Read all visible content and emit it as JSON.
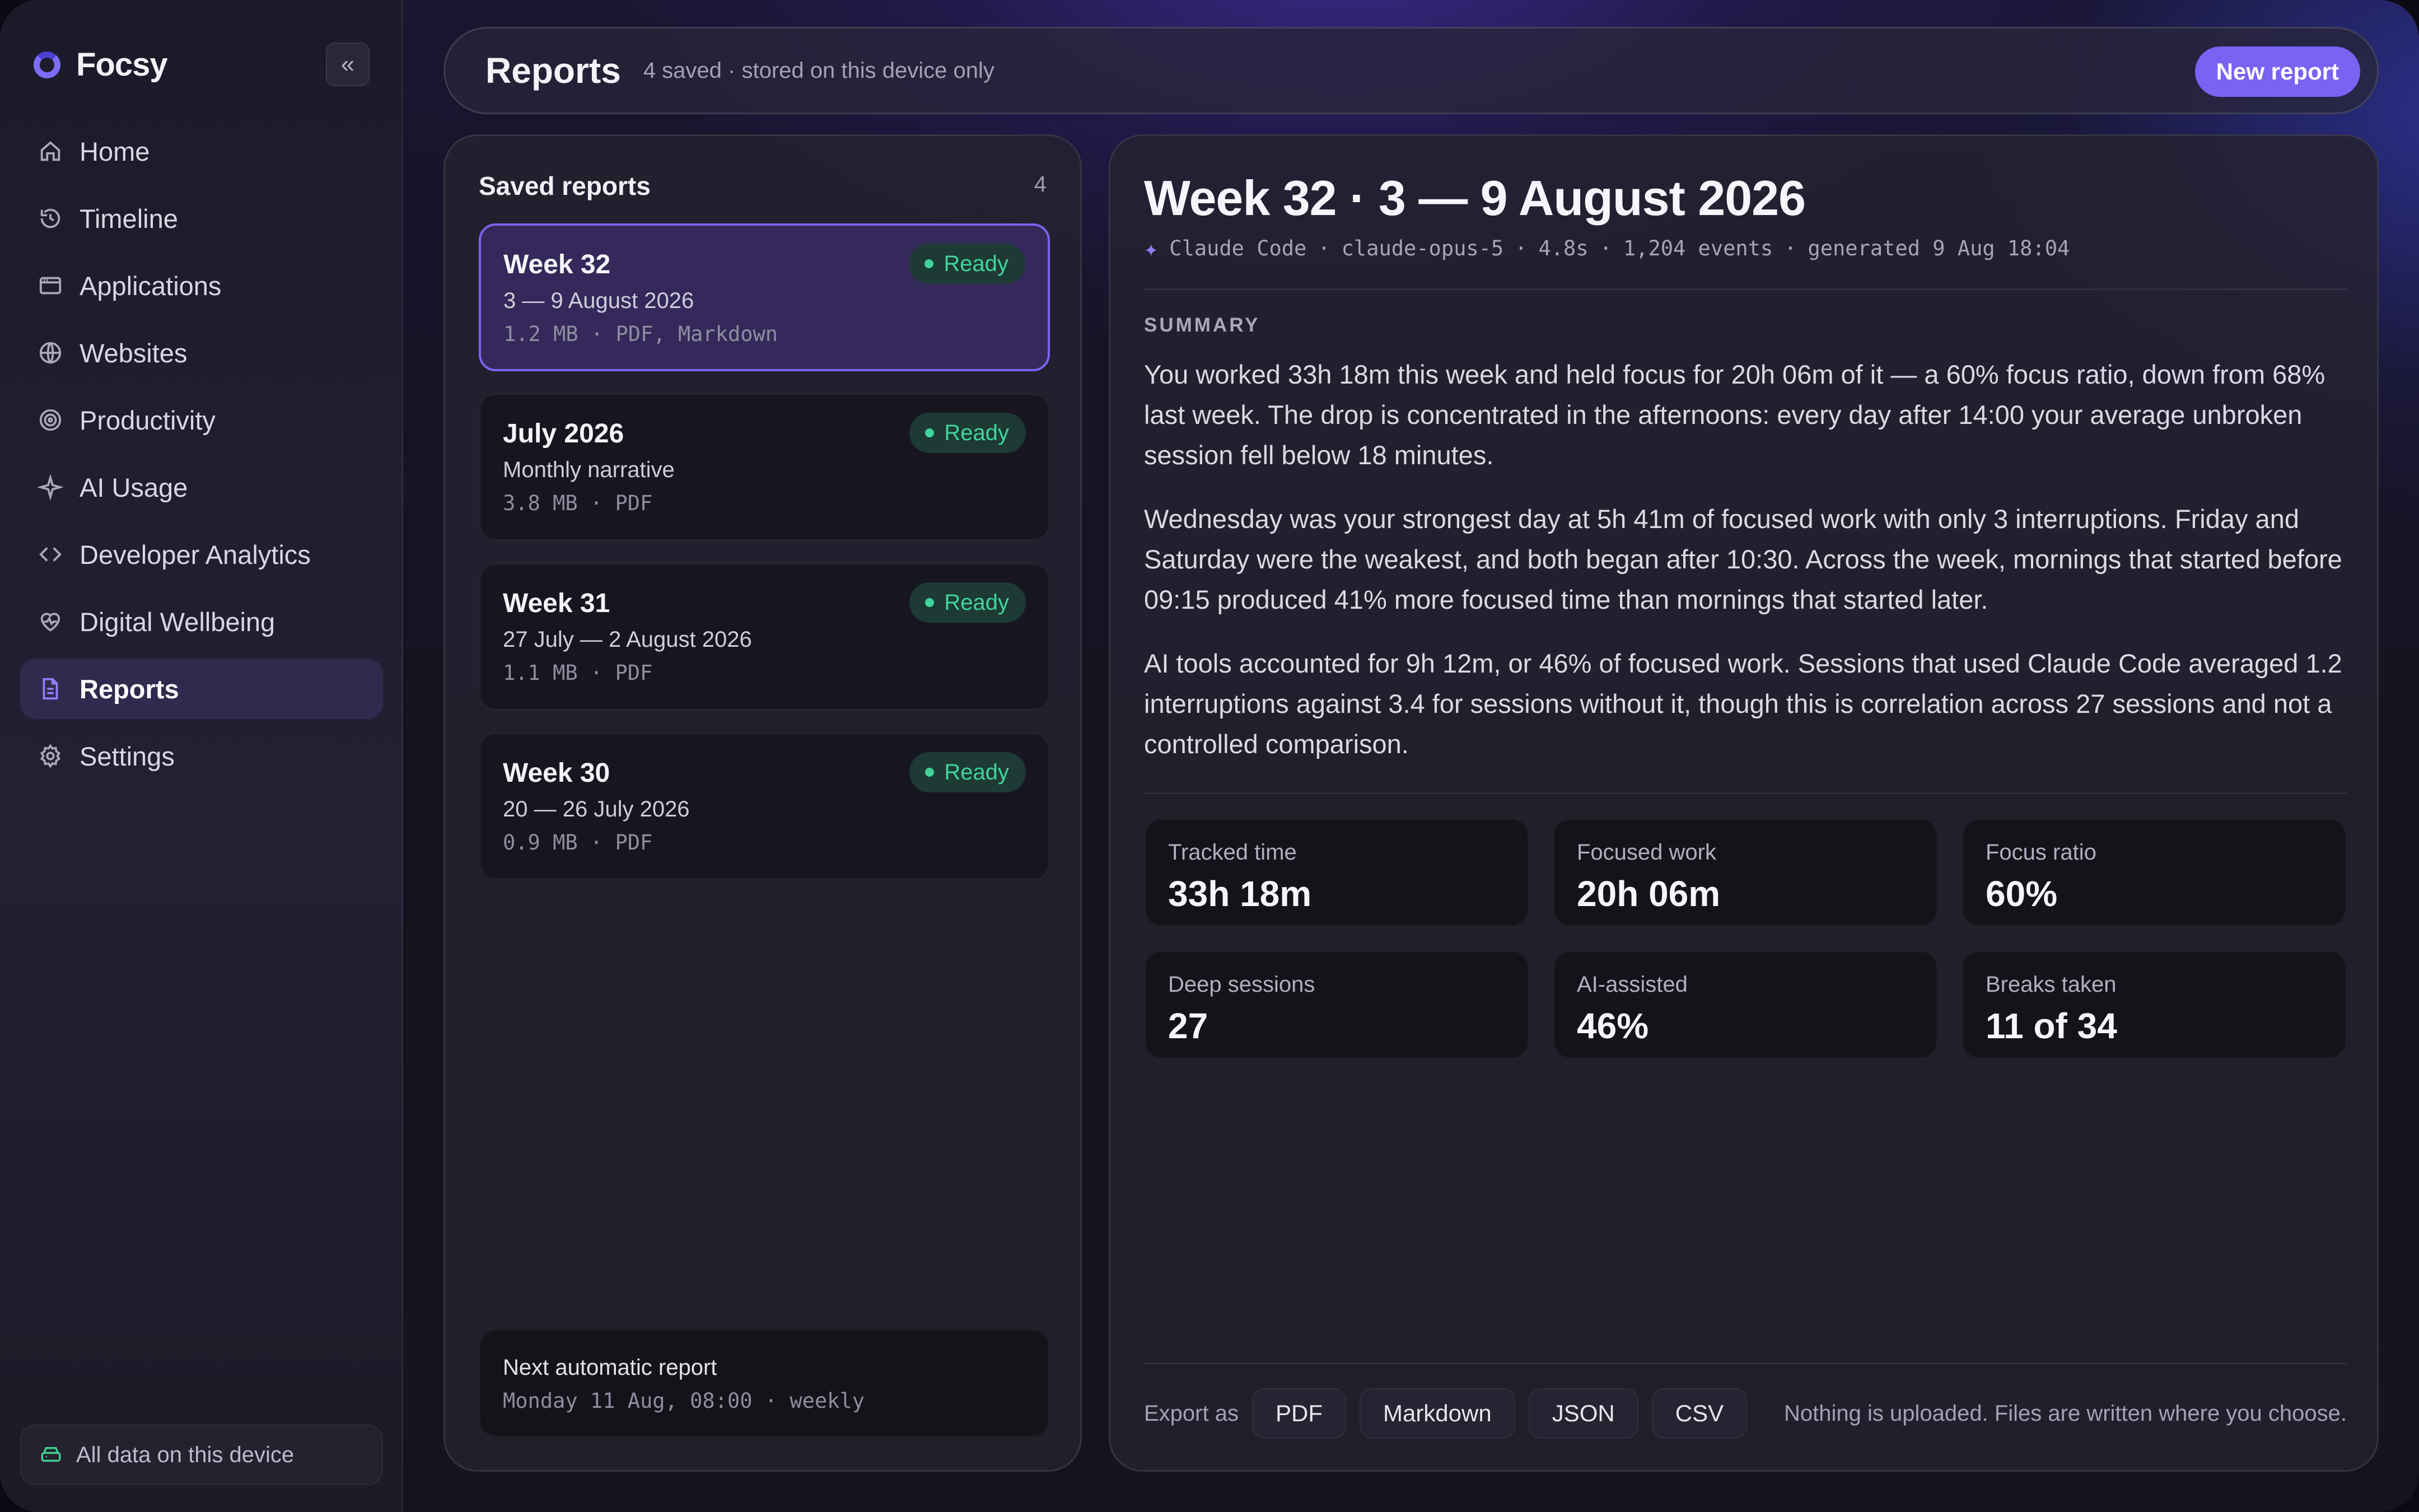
{
  "app": {
    "name": "Focsy"
  },
  "sidebar": {
    "collapse_glyph": "«",
    "items": [
      {
        "label": "Home",
        "icon": "home-icon"
      },
      {
        "label": "Timeline",
        "icon": "history-icon"
      },
      {
        "label": "Applications",
        "icon": "window-icon"
      },
      {
        "label": "Websites",
        "icon": "globe-icon"
      },
      {
        "label": "Productivity",
        "icon": "target-icon"
      },
      {
        "label": "AI Usage",
        "icon": "sparkle-icon"
      },
      {
        "label": "Developer Analytics",
        "icon": "code-icon"
      },
      {
        "label": "Digital Wellbeing",
        "icon": "heart-pulse-icon"
      },
      {
        "label": "Reports",
        "icon": "document-icon",
        "active": true
      },
      {
        "label": "Settings",
        "icon": "gear-icon"
      }
    ],
    "footer": "All data on this device"
  },
  "header": {
    "title": "Reports",
    "subtitle": "4 saved · stored on this device only",
    "new_report_label": "New report"
  },
  "saved_reports": {
    "title": "Saved reports",
    "count": "4",
    "items": [
      {
        "title": "Week 32",
        "subtitle": "3 — 9 August 2026",
        "meta": "1.2 MB · PDF, Markdown",
        "status": "Ready",
        "selected": true
      },
      {
        "title": "July 2026",
        "subtitle": "Monthly narrative",
        "meta": "3.8 MB · PDF",
        "status": "Ready"
      },
      {
        "title": "Week 31",
        "subtitle": "27 July — 2 August 2026",
        "meta": "1.1 MB · PDF",
        "status": "Ready"
      },
      {
        "title": "Week 30",
        "subtitle": "20 — 26 July 2026",
        "meta": "0.9 MB · PDF",
        "status": "Ready"
      }
    ],
    "next": {
      "title": "Next automatic report",
      "meta": "Monday 11 Aug, 08:00 · weekly"
    }
  },
  "report": {
    "title": "Week 32 · 3 — 9 August 2026",
    "meta": {
      "spark": "✦",
      "tool": "Claude Code",
      "model": "claude-opus-5",
      "duration": "4.8s",
      "events": "1,204 events",
      "generated": "generated 9 Aug 18:04",
      "sep": "·"
    },
    "summary_label": "SUMMARY",
    "paragraphs": [
      "You worked 33h 18m this week and held focus for 20h 06m of it — a 60% focus ratio, down from 68% last week. The drop is concentrated in the afternoons: every day after 14:00 your average unbroken session fell below 18 minutes.",
      "Wednesday was your strongest day at 5h 41m of focused work with only 3 interruptions. Friday and Saturday were the weakest, and both began after 10:30. Across the week, mornings that started before 09:15 produced 41% more focused time than mornings that started later.",
      "AI tools accounted for 9h 12m, or 46% of focused work. Sessions that used Claude Code averaged 1.2 interruptions against 3.4 for sessions without it, though this is correlation across 27 sessions and not a controlled comparison."
    ],
    "stats": [
      {
        "label": "Tracked time",
        "value": "33h 18m"
      },
      {
        "label": "Focused work",
        "value": "20h 06m"
      },
      {
        "label": "Focus ratio",
        "value": "60%"
      },
      {
        "label": "Deep sessions",
        "value": "27"
      },
      {
        "label": "AI-assisted",
        "value": "46%"
      },
      {
        "label": "Breaks taken",
        "value": "11 of 34"
      }
    ],
    "export": {
      "label": "Export as",
      "formats": [
        "PDF",
        "Markdown",
        "JSON",
        "CSV"
      ],
      "note": "Nothing is uploaded. Files are written where you choose."
    }
  },
  "colors": {
    "accent": "#7a62f2",
    "ready_green": "#3fd49b",
    "selected_card": "#34295a"
  }
}
